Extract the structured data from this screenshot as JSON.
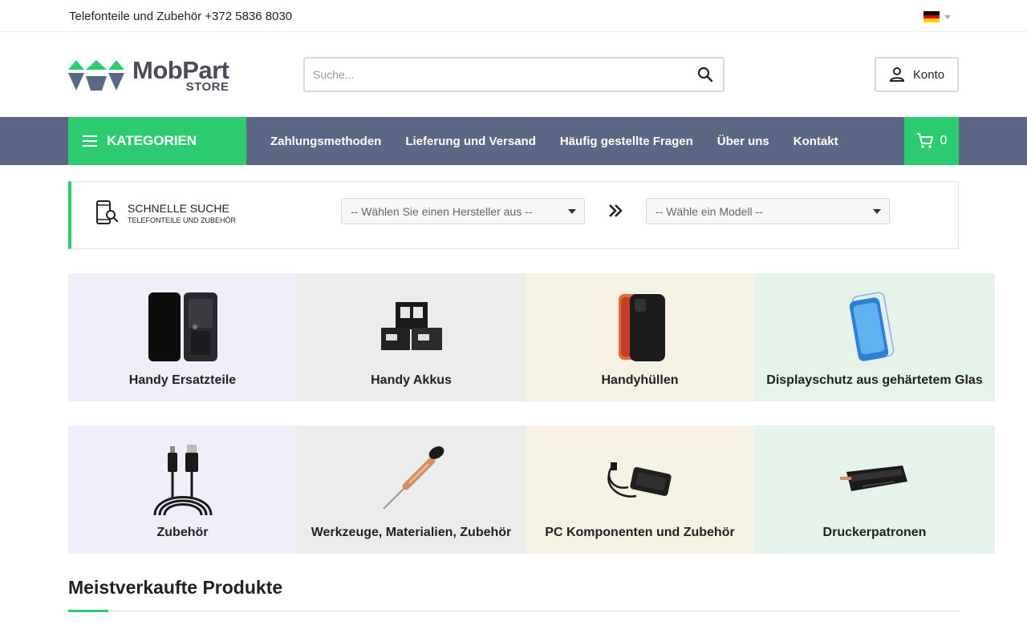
{
  "topbar": {
    "contact_text": "Telefonteile und Zubehör +372 5836 8030",
    "language_flag": "german-flag-icon"
  },
  "header": {
    "logo_main": "MobPart",
    "logo_sub": "STORE",
    "search_placeholder": "Suche...",
    "search_icon": "search-icon",
    "account_label": "Konto"
  },
  "nav": {
    "categories_label": "KATEGORIEN",
    "links": [
      "Zahlungsmethoden",
      "Lieferung und Versand",
      "Häufig gestellte Fragen",
      "Über uns",
      "Kontakt"
    ],
    "cart_count": "0"
  },
  "quick_search": {
    "title": "SCHNELLE SUCHE",
    "subtitle": "TELEFONTEILE UND ZUBEHÖR",
    "manufacturer_placeholder": "-- Wählen Sie einen Hersteller aus --",
    "model_placeholder": "-- Wähle ein Modell --"
  },
  "categories": [
    {
      "label": "Handy Ersatzteile",
      "icon": "phone-screen-icon"
    },
    {
      "label": "Handy Akkus",
      "icon": "battery-icon"
    },
    {
      "label": "Handyhüllen",
      "icon": "phone-case-icon"
    },
    {
      "label": "Displayschutz aus gehärtetem Glas",
      "icon": "screen-protector-icon"
    },
    {
      "label": "Zubehör",
      "icon": "usb-cable-icon"
    },
    {
      "label": "Werkzeuge, Materialien, Zubehör",
      "icon": "screwdriver-icon"
    },
    {
      "label": "PC Komponenten und Zubehör",
      "icon": "power-adapter-icon"
    },
    {
      "label": "Druckerpatronen",
      "icon": "toner-cartridge-icon"
    }
  ],
  "bestsellers": {
    "title": "Meistverkaufte Produkte"
  },
  "colors": {
    "accent_green": "#2ecc71",
    "nav_slate": "#5b6785"
  }
}
